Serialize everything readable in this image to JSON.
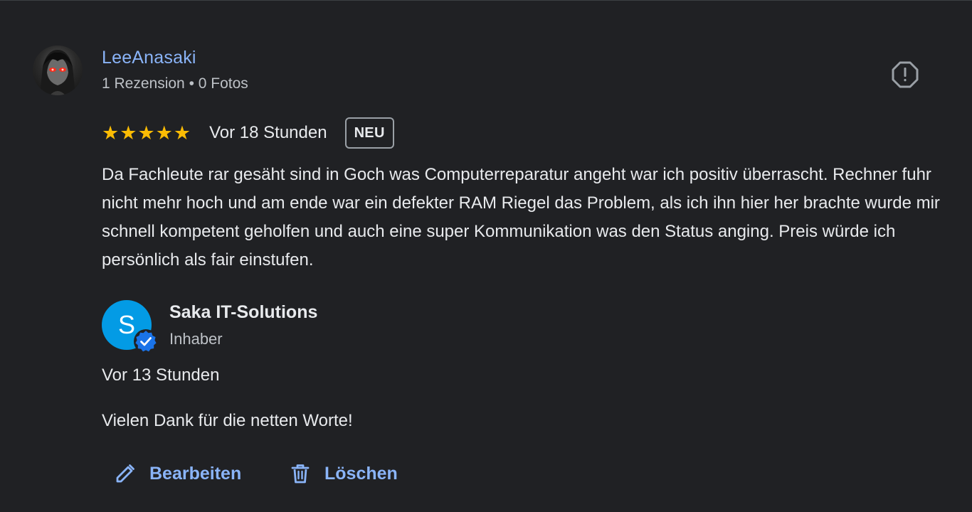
{
  "reviewer": {
    "name": "LeeAnasaki",
    "meta": "1 Rezension • 0 Fotos",
    "avatar_icon": "user-avatar-image"
  },
  "review": {
    "rating": 5,
    "rating_max": 5,
    "time": "Vor 18 Stunden",
    "badge": "NEU",
    "text": "Da Fachleute rar gesäht sind in Goch was Computerreparatur angeht war ich positiv überrascht. Rechner fuhr nicht mehr hoch und am ende war ein defekter RAM Riegel das Problem, als ich ihn hier her brachte wurde mir schnell kompetent geholfen und auch eine super Kommunikation was den Status anging. Preis würde ich persönlich als fair einstufen."
  },
  "owner_reply": {
    "avatar_letter": "S",
    "name": "Saka IT-Solutions",
    "role": "Inhaber",
    "time": "Vor 13 Stunden",
    "text": "Vielen Dank für die netten Worte!"
  },
  "actions": {
    "edit_label": "Bearbeiten",
    "delete_label": "Löschen"
  },
  "icons": {
    "report": "report-icon",
    "edit": "pencil-icon",
    "delete": "trash-icon",
    "verified": "verified-badge-icon"
  },
  "colors": {
    "background": "#202124",
    "link": "#8ab4f8",
    "star": "#fbbc04",
    "owner_avatar": "#039be5",
    "verified": "#1a73e8"
  }
}
